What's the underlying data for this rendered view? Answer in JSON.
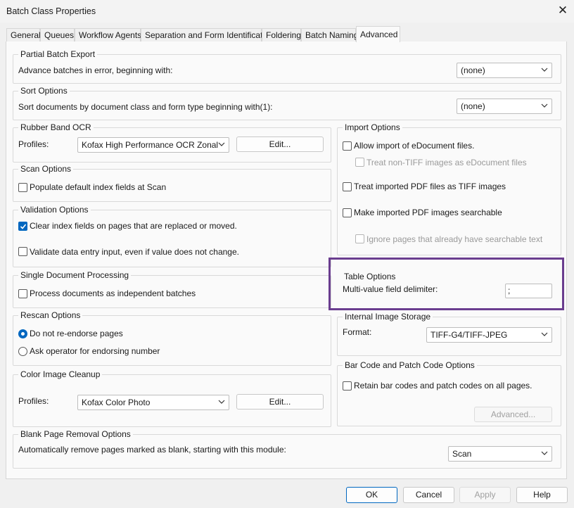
{
  "window": {
    "title": "Batch Class Properties"
  },
  "tabs": [
    "General",
    "Queues",
    "Workflow Agents",
    "Separation and Form Identification",
    "Foldering",
    "Batch Naming",
    "Advanced"
  ],
  "partial_export": {
    "legend": "Partial Batch Export",
    "label": "Advance batches in error, beginning with:",
    "value": "(none)"
  },
  "sort_options": {
    "legend": "Sort Options",
    "label": "Sort documents by document class and form type beginning with(1):",
    "value": "(none)"
  },
  "rubber_band": {
    "legend": "Rubber Band OCR",
    "profiles_label": "Profiles:",
    "profile_value": "Kofax High Performance OCR Zonal",
    "edit_label": "Edit..."
  },
  "scan_options": {
    "legend": "Scan Options",
    "populate_label": "Populate default index fields at Scan",
    "populate_checked": false
  },
  "validation": {
    "legend": "Validation Options",
    "clear_label": "Clear index fields on pages that are replaced or moved.",
    "clear_checked": true,
    "validate_label": "Validate data entry input, even if value does not change.",
    "validate_checked": false
  },
  "single_doc": {
    "legend": "Single Document Processing",
    "process_label": "Process documents as independent batches",
    "process_checked": false
  },
  "rescan": {
    "legend": "Rescan Options",
    "no_reendorse_label": "Do not re-endorse pages",
    "ask_operator_label": "Ask operator for endorsing number",
    "selected": "no_reendorse"
  },
  "color_cleanup": {
    "legend": "Color Image Cleanup",
    "profiles_label": "Profiles:",
    "profile_value": "Kofax Color Photo",
    "edit_label": "Edit..."
  },
  "import_options": {
    "legend": "Import Options",
    "allow_edoc_label": "Allow import of eDocument files.",
    "treat_non_tiff_label": "Treat non-TIFF images as eDocument files",
    "treat_pdf_label": "Treat imported PDF files as TIFF images",
    "make_searchable_label": "Make imported PDF images searchable",
    "ignore_pages_label": "Ignore pages that already have searchable text"
  },
  "table_options": {
    "legend": "Table Options",
    "delimiter_label": "Multi-value field delimiter:",
    "delimiter_value": ";"
  },
  "image_storage": {
    "legend": "Internal Image Storage",
    "format_label": "Format:",
    "format_value": "TIFF-G4/TIFF-JPEG"
  },
  "barcode": {
    "legend": "Bar Code and Patch Code Options",
    "retain_label": "Retain bar codes and patch codes on all pages.",
    "advanced_label": "Advanced..."
  },
  "blank_page": {
    "legend": "Blank Page Removal Options",
    "label": "Automatically remove pages marked as blank, starting with this module:",
    "value": "Scan"
  },
  "footer": {
    "ok": "OK",
    "cancel": "Cancel",
    "apply": "Apply",
    "help": "Help"
  },
  "colors": {
    "accent": "#0067c0",
    "highlight": "#6a3d8f"
  }
}
